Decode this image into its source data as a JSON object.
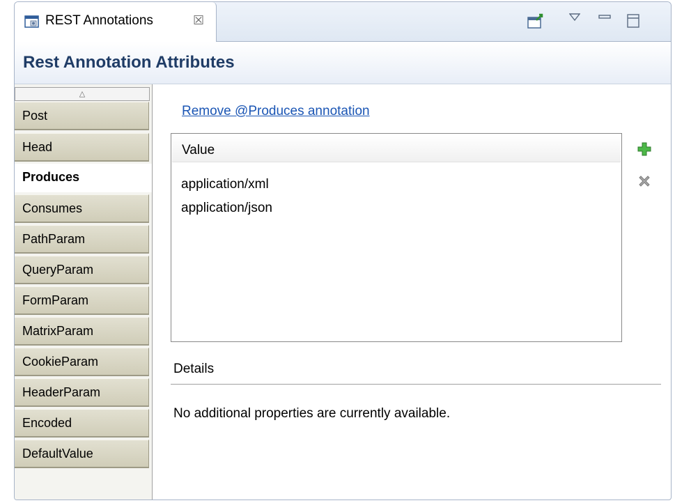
{
  "view_tab": {
    "title": "REST Annotations",
    "icons": [
      "rest-view-icon",
      "close-icon"
    ]
  },
  "toolbar": {
    "icons": [
      "open-editor-icon",
      "view-menu-icon",
      "minimize-icon",
      "maximize-icon"
    ]
  },
  "header": {
    "title": "Rest Annotation Attributes"
  },
  "sections": {
    "items": [
      "Post",
      "Head",
      "Produces",
      "Consumes",
      "PathParam",
      "QueryParam",
      "FormParam",
      "MatrixParam",
      "CookieParam",
      "HeaderParam",
      "Encoded",
      "DefaultValue"
    ],
    "selected": "Produces"
  },
  "main": {
    "remove_link": "Remove @Produces annotation",
    "table": {
      "column": "Value",
      "rows": [
        "application/xml",
        "application/json"
      ]
    },
    "details_label": "Details",
    "details_text": "No additional properties are currently available."
  },
  "colors": {
    "header_title": "#1f3c66",
    "link": "#1a55b4",
    "add_icon": "#3ea63a",
    "remove_icon": "#9a9a9a"
  }
}
